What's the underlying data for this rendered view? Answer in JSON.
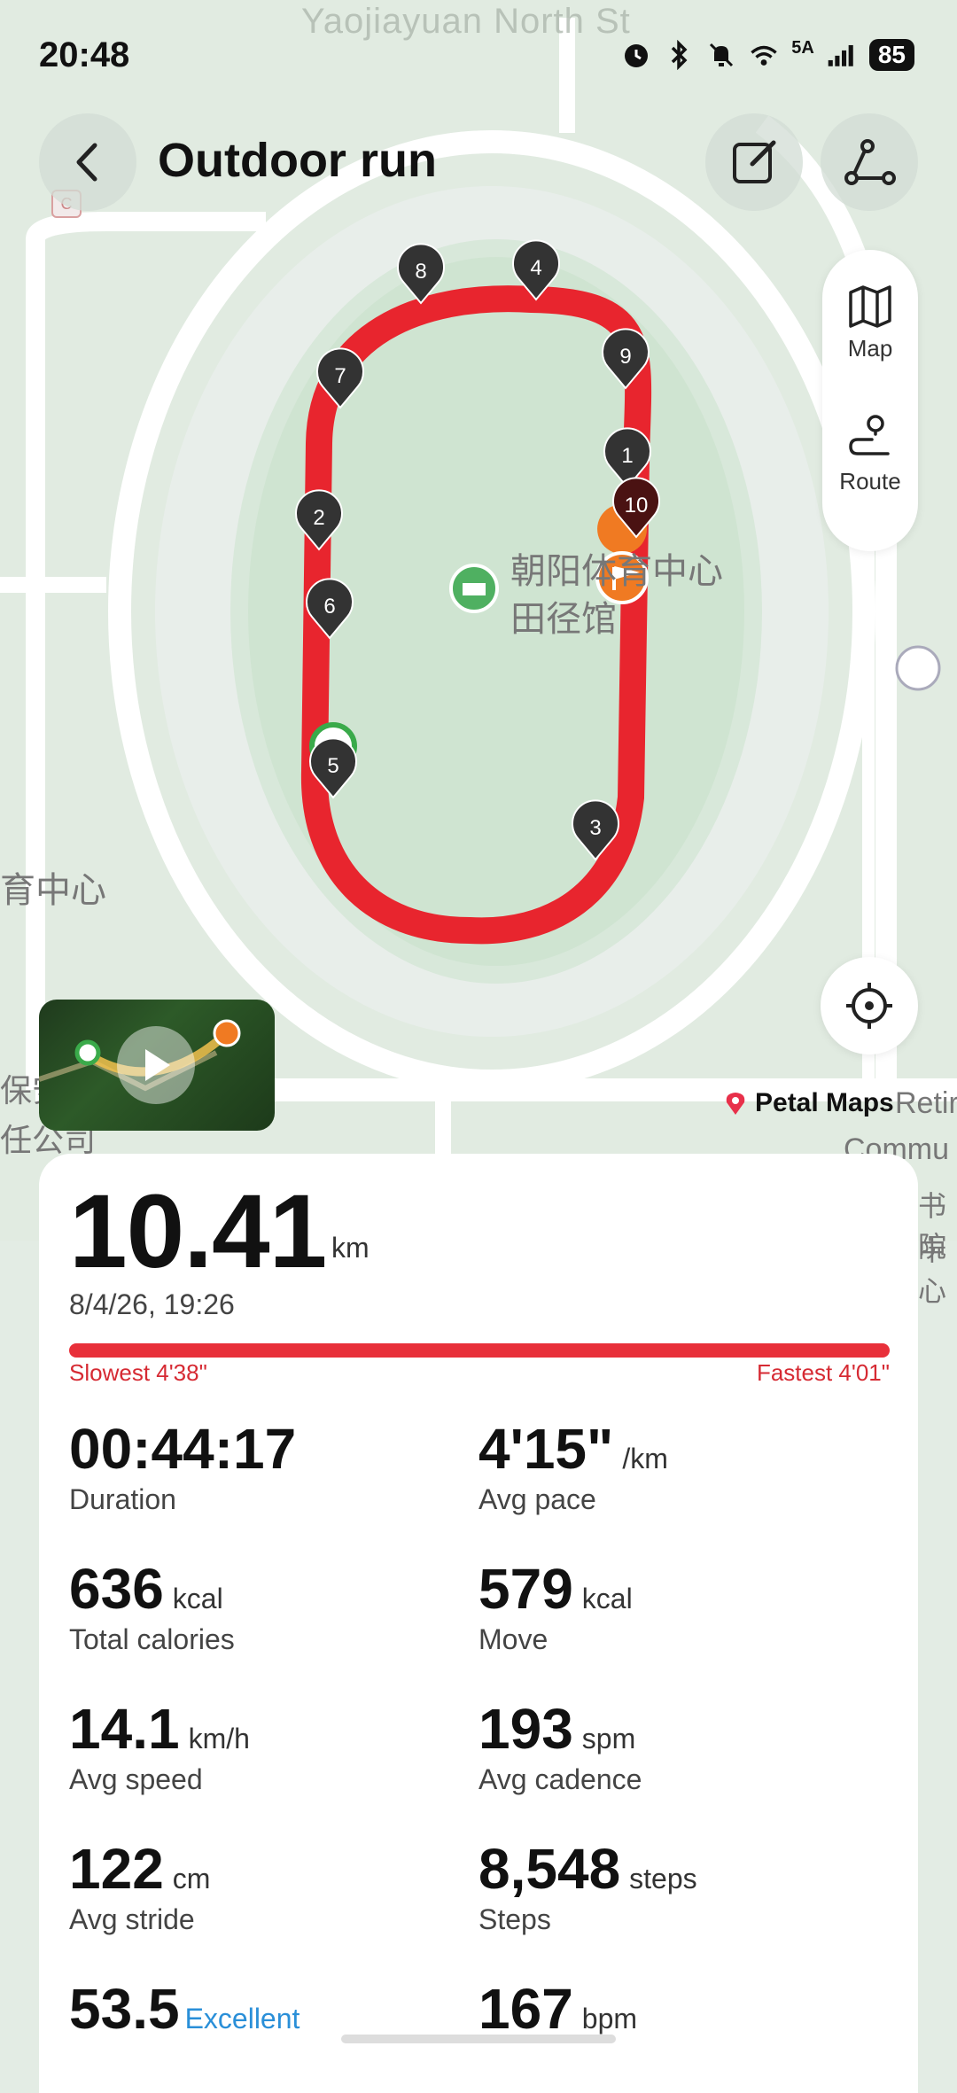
{
  "status_bar": {
    "time": "20:48",
    "network": "5A",
    "battery": "85"
  },
  "header": {
    "title": "Outdoor run",
    "street_label": "Yaojiayuan North St",
    "c_badge": "C"
  },
  "map": {
    "venue_label_line1": "朝阳体育中心",
    "venue_label_line2": "田径馆",
    "left_label": "育中心",
    "left_bottom_line1": "保安",
    "left_bottom_line2": "任公司",
    "right_label_1": "Retirem",
    "right_label_2": "Commu",
    "right_label_3": "书院",
    "right_label_4": "中心",
    "km_markers": [
      "1",
      "2",
      "3",
      "4",
      "5",
      "6",
      "7",
      "8",
      "9",
      "10"
    ],
    "route_color": "#e8252e",
    "start_color": "#3aaa4a",
    "finish_color": "#f07a22",
    "attribution": "Petal Maps",
    "controls": {
      "map_label": "Map",
      "route_label": "Route"
    }
  },
  "summary": {
    "distance": "10.41",
    "distance_unit": "km",
    "datetime": "8/4/26, 19:26",
    "slowest": "Slowest 4'38\"",
    "fastest": "Fastest 4'01\""
  },
  "stats": [
    {
      "value": "00:44:17",
      "unit": "",
      "label": "Duration"
    },
    {
      "value": "4'15\"",
      "unit": "/km",
      "label": "Avg pace"
    },
    {
      "value": "636",
      "unit": "kcal",
      "label": "Total calories"
    },
    {
      "value": "579",
      "unit": "kcal",
      "label": "Move"
    },
    {
      "value": "14.1",
      "unit": "km/h",
      "label": "Avg speed"
    },
    {
      "value": "193",
      "unit": "spm",
      "label": "Avg cadence"
    },
    {
      "value": "122",
      "unit": "cm",
      "label": "Avg stride"
    },
    {
      "value": "8,548",
      "unit": "steps",
      "label": "Steps"
    },
    {
      "value": "53.5",
      "unit": "Excellent",
      "label": ""
    },
    {
      "value": "167",
      "unit": "bpm",
      "label": ""
    }
  ]
}
